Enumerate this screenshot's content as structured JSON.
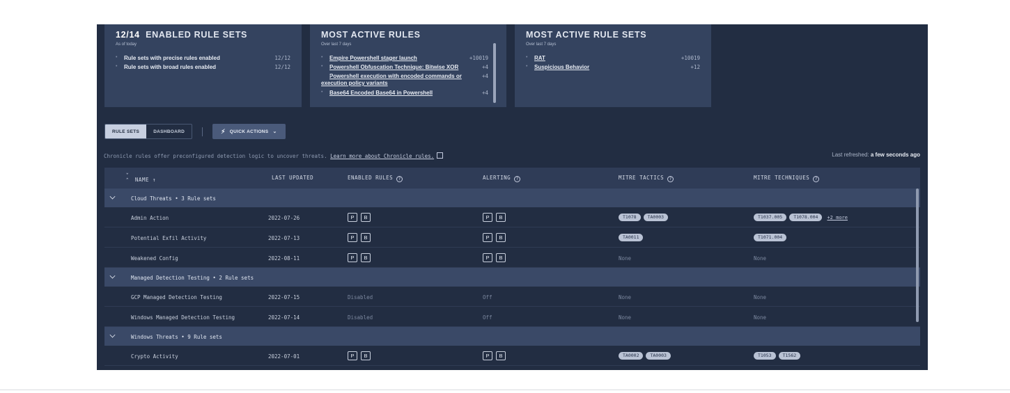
{
  "cards": {
    "enabled": {
      "count": "12/14",
      "title": "ENABLED RULE SETS",
      "subtitle": "As of today",
      "items": [
        {
          "label": "Rule sets with precise rules enabled",
          "value": "12/12"
        },
        {
          "label": "Rule sets with broad rules enabled",
          "value": "12/12"
        }
      ]
    },
    "active_rules": {
      "title": "MOST ACTIVE RULES",
      "subtitle": "Over last 7 days",
      "items": [
        {
          "label": "Empire Powershell stager launch",
          "value": "+10019"
        },
        {
          "label": "Powershell Obfuscation Technique: Bitwise XOR",
          "value": "+4"
        },
        {
          "label": "Powershell execution with encoded commands or execution policy variants",
          "value": "+4"
        },
        {
          "label": "Base64 Encoded Base64 in Powershell",
          "value": "+4"
        }
      ]
    },
    "active_rule_sets": {
      "title": "MOST ACTIVE RULE SETS",
      "subtitle": "Over last 7 days",
      "items": [
        {
          "label": "RAT",
          "value": "+10019"
        },
        {
          "label": "Suspicious Behavior",
          "value": "+12"
        }
      ]
    }
  },
  "toolbar": {
    "tab_rule_sets": "RULE SETS",
    "tab_dashboard": "DASHBOARD",
    "quick_actions": "QUICK ACTIONS"
  },
  "info": {
    "text": "Chronicle rules offer preconfigured detection logic to uncover threats. ",
    "link": "Learn more about Chronicle rules."
  },
  "refresh": {
    "label": "Last refreshed: ",
    "value": "a few seconds ago"
  },
  "table": {
    "headers": {
      "name": "NAME ↑",
      "updated": "LAST UPDATED",
      "enabled": "ENABLED RULES",
      "alerting": "ALERTING",
      "tactics": "MITRE TACTICS",
      "techniques": "MITRE TECHNIQUES"
    },
    "pb": {
      "p": "P",
      "b": "B"
    },
    "groups": [
      {
        "label": "Cloud Threats  •  3 Rule sets",
        "rows": [
          {
            "name": "Admin Action",
            "updated": "2022-07-26",
            "tactics": [
              "T1078",
              "TA0003"
            ],
            "techniques": [
              "T1037.005",
              "T1078.004"
            ],
            "more": "+2 more"
          },
          {
            "name": "Potential Exfil Activity",
            "updated": "2022-07-13",
            "tactics": [
              "TA0011"
            ],
            "techniques": [
              "T1071.004"
            ]
          },
          {
            "name": "Weakened Config",
            "updated": "2022-08-11",
            "tactics_none": "None",
            "techniques_none": "None"
          }
        ]
      },
      {
        "label": "Managed Detection Testing  •  2 Rule sets",
        "rows": [
          {
            "name": "GCP Managed Detection Testing",
            "updated": "2022-07-15",
            "enabled": "Disabled",
            "alerting": "Off",
            "tactics_none": "None",
            "techniques_none": "None"
          },
          {
            "name": "Windows Managed Detection Testing",
            "updated": "2022-07-14",
            "enabled": "Disabled",
            "alerting": "Off",
            "tactics_none": "None",
            "techniques_none": "None"
          }
        ]
      },
      {
        "label": "Windows Threats  •  9 Rule sets",
        "rows": [
          {
            "name": "Crypto Activity",
            "updated": "2022-07-01",
            "tactics": [
              "TA0002",
              "TA0003"
            ],
            "techniques": [
              "T1053",
              "T1562"
            ]
          }
        ]
      }
    ]
  }
}
